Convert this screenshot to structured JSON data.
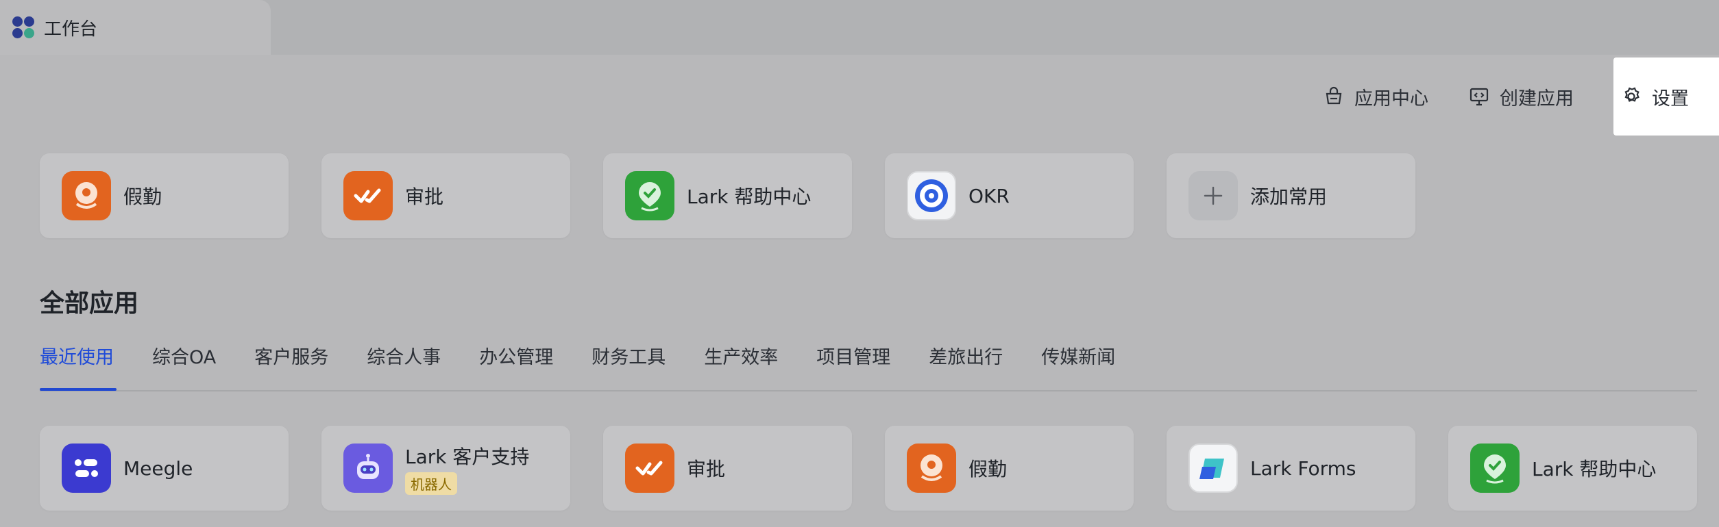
{
  "window": {
    "tab_title": "工作台"
  },
  "header": {
    "actions": [
      {
        "label": "应用中心",
        "icon": "app-store-icon"
      },
      {
        "label": "创建应用",
        "icon": "code-monitor-icon"
      },
      {
        "label": "设置",
        "icon": "gear-icon"
      }
    ]
  },
  "favorites": [
    {
      "label": "假勤",
      "icon": "attendance-icon"
    },
    {
      "label": "审批",
      "icon": "approval-icon"
    },
    {
      "label": "Lark 帮助中心",
      "icon": "help-center-icon"
    },
    {
      "label": "OKR",
      "icon": "okr-icon"
    },
    {
      "label": "添加常用",
      "icon": "plus-icon"
    }
  ],
  "all_apps": {
    "title": "全部应用",
    "categories": [
      "最近使用",
      "综合OA",
      "客户服务",
      "综合人事",
      "办公管理",
      "财务工具",
      "生产效率",
      "项目管理",
      "差旅出行",
      "传媒新闻"
    ],
    "active_category": "最近使用",
    "apps": [
      {
        "label": "Meegle",
        "icon": "meegle-icon"
      },
      {
        "label": "Lark 客户支持",
        "tag": "机器人",
        "icon": "bot-icon"
      },
      {
        "label": "审批",
        "icon": "approval-icon"
      },
      {
        "label": "假勤",
        "icon": "attendance-icon"
      },
      {
        "label": "Lark Forms",
        "icon": "forms-icon"
      },
      {
        "label": "Lark 帮助中心",
        "icon": "help-center-icon"
      }
    ]
  },
  "colors": {
    "accent": "#1f4bd8",
    "orange": "#e2641f",
    "green": "#2ea23a",
    "overlay": "#b8b8ba"
  }
}
